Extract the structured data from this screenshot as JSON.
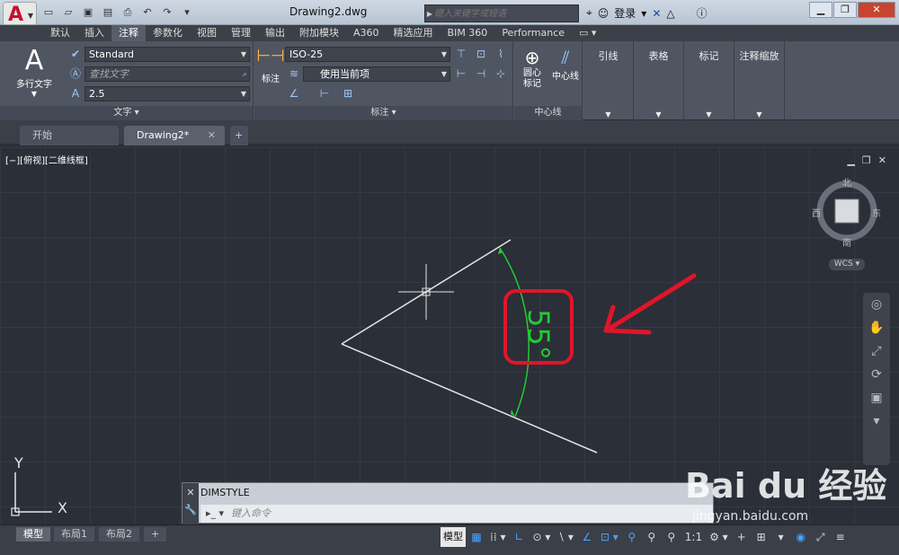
{
  "titlebar": {
    "app_letter": "A",
    "document_title": "Drawing2.dwg",
    "search_placeholder": "键入关键字或短语",
    "login_label": "登录"
  },
  "menu_tabs": [
    "默认",
    "插入",
    "注释",
    "参数化",
    "视图",
    "管理",
    "输出",
    "附加模块",
    "A360",
    "精选应用",
    "BIM 360",
    "Performance"
  ],
  "ribbon": {
    "text_panel": {
      "multiline_text_label": "多行文字",
      "style_value": "Standard",
      "find_placeholder": "查找文字",
      "height_value": "2.5",
      "footer": "文字"
    },
    "dim_panel": {
      "dimension_label": "标注",
      "dim_style_value": "ISO-25",
      "layer_value": "使用当前项",
      "footer": "标注"
    },
    "centerline_panel": {
      "center_mark_label": "圆心\n标记",
      "centerline_label": "中心线",
      "footer": "中心线"
    },
    "leader_label": "引线",
    "table_label": "表格",
    "markup_label": "标记",
    "annotation_scale_label": "注释缩放"
  },
  "file_tabs": {
    "start": "开始",
    "drawing": "Drawing2*"
  },
  "viewport": {
    "label": "[−][俯视][二维线框]",
    "angle_text": "55°",
    "compass": {
      "north": "北",
      "south": "南",
      "east": "东",
      "west": "西"
    },
    "wcs_label": "WCS",
    "ucs_x": "X",
    "ucs_y": "Y"
  },
  "command_line": {
    "history": "DIMSTYLE",
    "placeholder": "键入命令"
  },
  "layout_tabs": [
    "模型",
    "布局1",
    "布局2"
  ],
  "status": {
    "model_label": "模型",
    "scale_label": "1:1"
  },
  "watermark": {
    "brand": "Bai du 经验",
    "url": "jingyan.baidu.com"
  },
  "colors": {
    "dimension_green": "#22cc33",
    "highlight_red": "#e0152a",
    "line_white": "#e6e6e6",
    "app_red": "#c8102e"
  }
}
